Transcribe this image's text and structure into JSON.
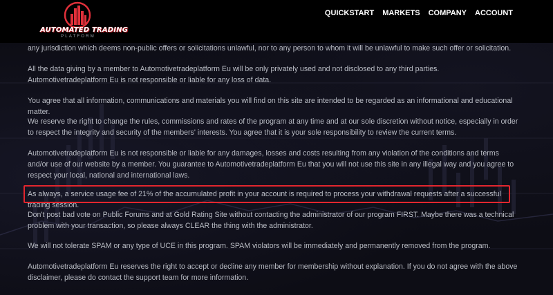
{
  "header": {
    "logo": {
      "title": "AUTOMATED TRADING",
      "subtitle": "PLATFORM"
    },
    "nav": [
      {
        "label": "QUICKSTART"
      },
      {
        "label": "MARKETS"
      },
      {
        "label": "COMPANY"
      },
      {
        "label": "ACCOUNT"
      }
    ]
  },
  "content": {
    "paragraphs": [
      "any jurisdiction which deems non-public offers or solicitations unlawful, nor to any person to whom it will be unlawful to make such offer or solicitation.",
      "All the data giving by a member to Automotivetradeplatform Eu will be only privately used and not disclosed to any third parties. Automotivetradeplatform Eu is not responsible or liable for any loss of data.",
      "You agree that all information, communications and materials you will find on this site are intended to be regarded as an informational and educational matter.",
      "We reserve the right to change the rules, commissions and rates of the program at any time and at our sole discretion without notice, especially in order to respect the integrity and security of the members' interests. You agree that it is your sole responsibility to review the current terms.",
      "Automotivetradeplatform Eu is not responsible or liable for any damages, losses and costs resulting from any violation of the conditions and terms and/or use of our website by a member. You guarantee to Automotivetradeplatform Eu that you will not use this site in any illegal way and you agree to respect your local, national and international laws.",
      "As always, a service usage fee of 21% of the accumulated profit in your account is required to process your withdrawal requests after a successful trading session.",
      "Don't post bad vote on Public Forums and at Gold Rating Site without contacting the administrator of our program FIRST. Maybe there was a technical problem with your transaction, so please always CLEAR the thing with the administrator.",
      "We will not tolerate SPAM or any type of UCE in this program. SPAM violators will be immediately and permanently removed from the program.",
      "Automotivetradeplatform Eu reserves the right to accept or decline any member for membership without explanation. If you do not agree with the above disclaimer, please do contact the support team for more information."
    ]
  },
  "colors": {
    "highlight_border": "#e3262e",
    "brand_red": "#e0303a"
  }
}
